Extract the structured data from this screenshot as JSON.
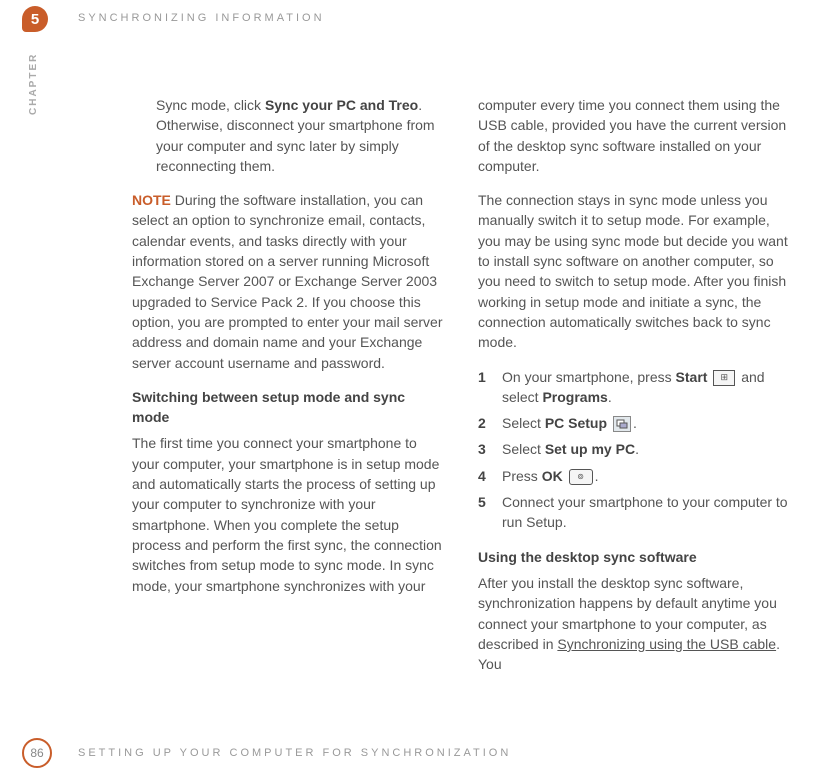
{
  "chapter": {
    "number": "5",
    "side_label": "CHAPTER",
    "header_title": "SYNCHRONIZING INFORMATION"
  },
  "col1": {
    "p1_a": "Sync mode, click ",
    "p1_bold": "Sync your PC and Treo",
    "p1_b": ". Otherwise, disconnect your smartphone from your computer and sync later by simply reconnecting them.",
    "note_label": "NOTE",
    "note_body": "  During the software installation, you can select an option to synchronize email, contacts, calendar events, and tasks directly with your information stored on a server running Microsoft Exchange Server 2007 or Exchange Server 2003 upgraded to Service Pack 2. If you choose this option, you are prompted to enter your mail server address and domain name and your Exchange server account username and password.",
    "subhead": "Switching between setup mode and sync mode",
    "p2": "The first time you connect your smartphone to your computer, your smartphone is in setup mode and automatically starts the process of setting up your computer to synchronize with your smartphone. When you complete the setup process and perform the first sync, the connection switches from setup mode to sync mode. In sync mode, your smartphone synchronizes with your"
  },
  "col2": {
    "p1": "computer every time you connect them using the USB cable, provided you have the current version of the desktop sync software installed on your computer.",
    "p2": "The connection stays in sync mode unless you manually switch it to setup mode. For example, you may be using sync mode but decide you want to install sync software on another computer, so you need to switch to setup mode. After you finish working in setup mode and initiate a sync, the connection automatically switches back to sync mode.",
    "steps": [
      {
        "num": "1",
        "a": "On your smartphone, press ",
        "bold1": "Start",
        "icon": "start",
        "b": " and select ",
        "bold2": "Programs",
        "c": "."
      },
      {
        "num": "2",
        "a": "Select ",
        "bold1": "PC Setup",
        "icon": "pcsetup",
        "c": "."
      },
      {
        "num": "3",
        "a": "Select ",
        "bold1": "Set up my PC",
        "c": "."
      },
      {
        "num": "4",
        "a": "Press ",
        "bold1": "OK",
        "icon": "ok",
        "c": "."
      },
      {
        "num": "5",
        "a": "Connect your smartphone to your computer to run Setup."
      }
    ],
    "subhead2": "Using the desktop sync software",
    "p3_a": "After you install the desktop sync software, synchronization happens by default anytime you connect your smartphone to your computer, as described in ",
    "p3_link": "Synchronizing using the USB cable",
    "p3_b": ". You"
  },
  "footer": {
    "page": "86",
    "title": "SETTING UP YOUR COMPUTER FOR SYNCHRONIZATION"
  },
  "icons": {
    "start_glyph": "⊞",
    "ok_glyph": "⊚"
  }
}
